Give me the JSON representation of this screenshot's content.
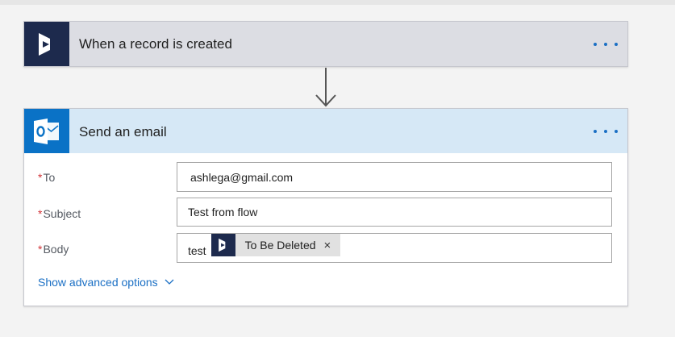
{
  "trigger": {
    "title": "When a record is created",
    "icon": "dynamics-icon",
    "icon_bg": "#1d2a4d",
    "header_bg": "#dcdde3"
  },
  "action": {
    "title": "Send an email",
    "icon": "outlook-icon",
    "icon_bg": "#0a72c6",
    "header_bg": "#d6e8f6",
    "fields": {
      "to": {
        "required_mark": "*",
        "label": "To",
        "value": "ashlega@gmail.com"
      },
      "subject": {
        "required_mark": "*",
        "label": "Subject",
        "value": "Test from flow"
      },
      "body": {
        "required_mark": "*",
        "label": "Body",
        "text": "test",
        "token": {
          "label": "To Be Deleted",
          "icon": "dynamics-icon",
          "remove": "×"
        }
      }
    },
    "advanced_link": "Show advanced options"
  },
  "colors": {
    "accent": "#1a6fc4",
    "required": "#d13438"
  }
}
